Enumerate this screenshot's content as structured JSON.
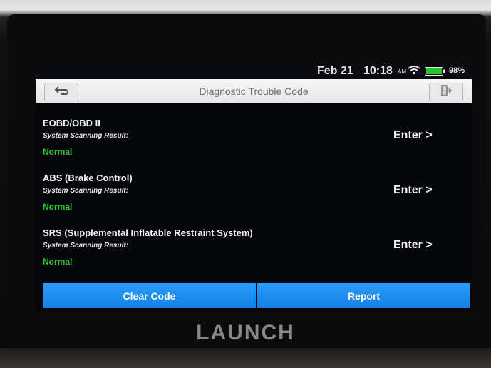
{
  "status_bar": {
    "date": "Feb 21",
    "time": "10:18",
    "ampm": "AM",
    "battery": "98%",
    "wifi_icon": "wifi-icon",
    "battery_icon": "battery-icon"
  },
  "title_bar": {
    "title": "Diagnostic Trouble Code",
    "back_icon": "back-arrow-icon",
    "exit_icon": "exit-icon"
  },
  "systems": [
    {
      "name": "EOBD/OBD II",
      "label": "System Scanning Result:",
      "status": "Normal",
      "action": "Enter >"
    },
    {
      "name": "ABS (Brake Control)",
      "label": "System Scanning Result:",
      "status": "Normal",
      "action": "Enter >"
    },
    {
      "name": "SRS (Supplemental Inflatable Restraint System)",
      "label": "System Scanning Result:",
      "status": "Normal",
      "action": "Enter >"
    }
  ],
  "buttons": {
    "clear_code": "Clear Code",
    "report": "Report"
  },
  "device": {
    "brand": "LAUNCH"
  },
  "colors": {
    "accent": "#1e8cf0",
    "normal_status": "#28cc28"
  }
}
